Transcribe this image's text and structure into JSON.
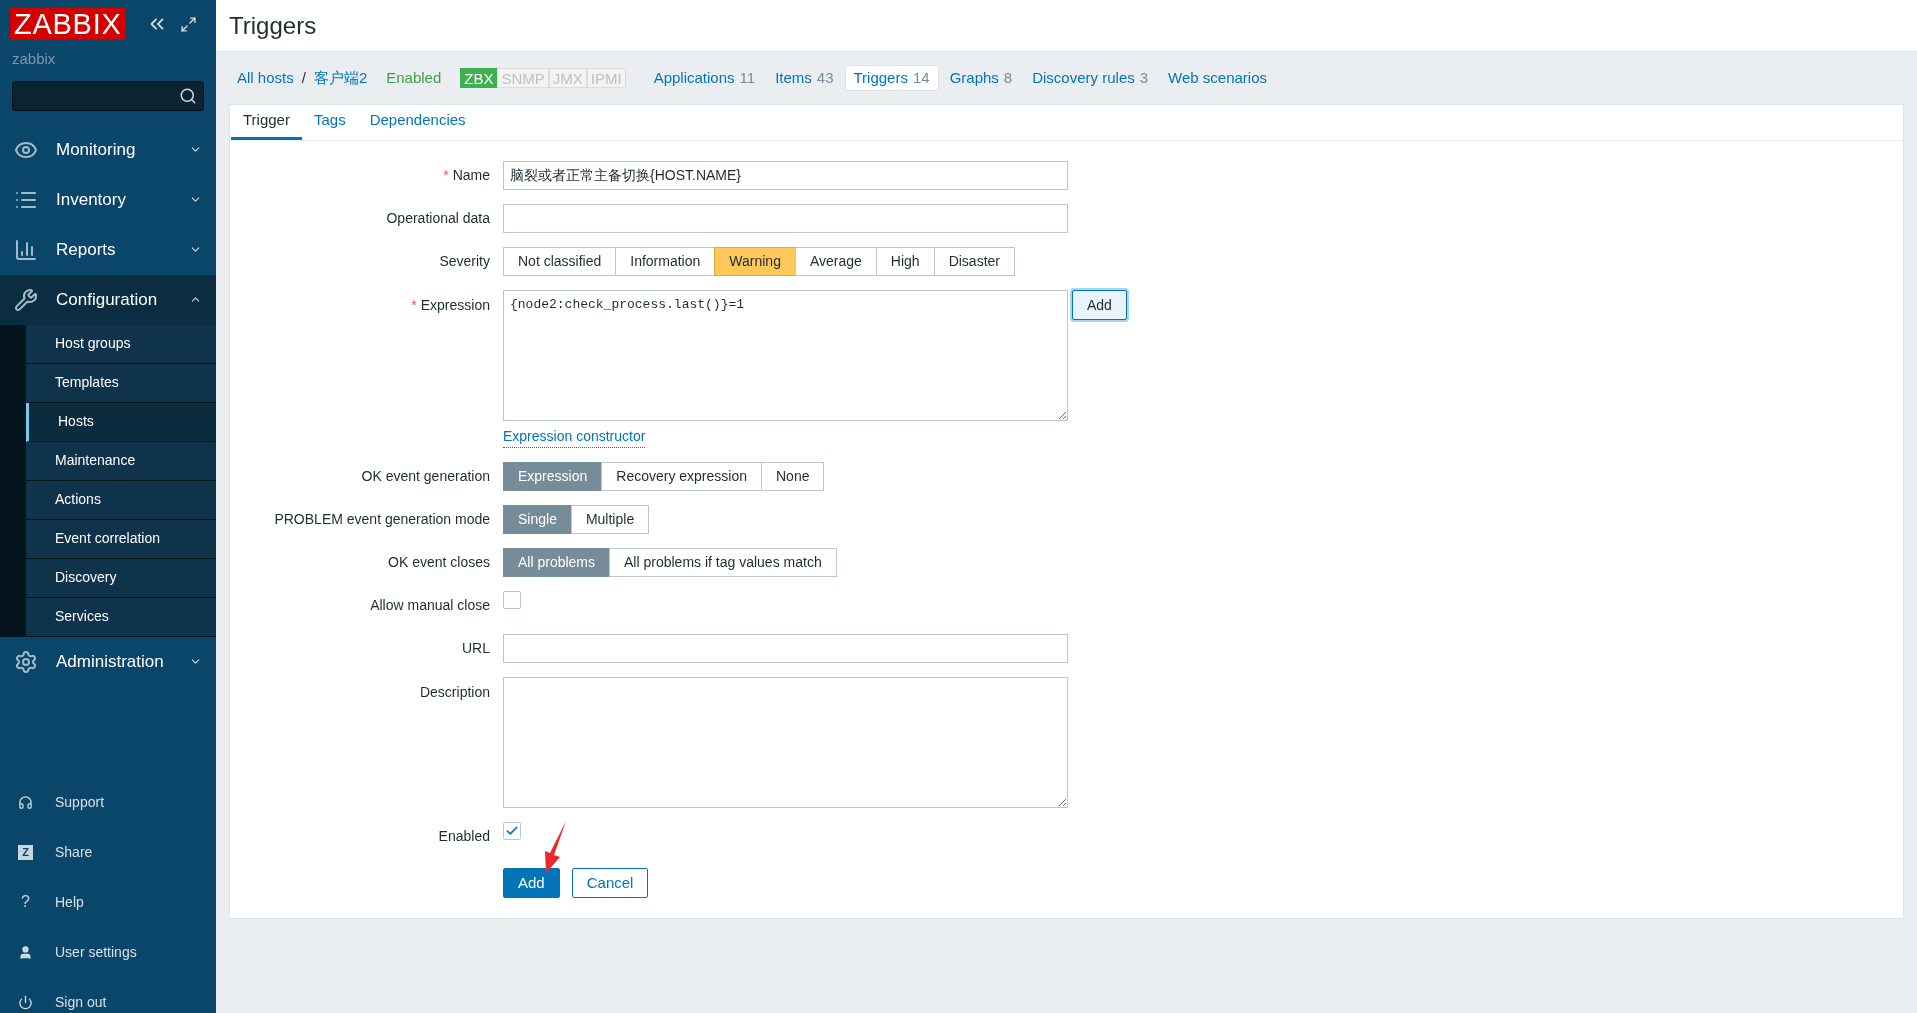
{
  "sidebar": {
    "logo": "ZABBIX",
    "user": "zabbix",
    "menu": [
      {
        "label": "Monitoring",
        "expanded": false
      },
      {
        "label": "Inventory",
        "expanded": false
      },
      {
        "label": "Reports",
        "expanded": false
      },
      {
        "label": "Configuration",
        "expanded": true,
        "children": [
          {
            "label": "Host groups",
            "selected": false
          },
          {
            "label": "Templates",
            "selected": false
          },
          {
            "label": "Hosts",
            "selected": true
          },
          {
            "label": "Maintenance",
            "selected": false
          },
          {
            "label": "Actions",
            "selected": false
          },
          {
            "label": "Event correlation",
            "selected": false
          },
          {
            "label": "Discovery",
            "selected": false
          },
          {
            "label": "Services",
            "selected": false
          }
        ]
      },
      {
        "label": "Administration",
        "expanded": false
      }
    ],
    "footer": [
      {
        "label": "Support"
      },
      {
        "label": "Share",
        "badge": "Z"
      },
      {
        "label": "Help",
        "badge": "?"
      },
      {
        "label": "User settings"
      },
      {
        "label": "Sign out"
      }
    ]
  },
  "page": {
    "title": "Triggers"
  },
  "host_nav": {
    "breadcrumbs": [
      "All hosts",
      "客户端2"
    ],
    "separator": "/",
    "status": "Enabled",
    "availability": [
      {
        "label": "ZBX",
        "on": true
      },
      {
        "label": "SNMP",
        "on": false
      },
      {
        "label": "JMX",
        "on": false
      },
      {
        "label": "IPMI",
        "on": false
      }
    ],
    "links": [
      {
        "label": "Applications",
        "count": "11",
        "selected": false
      },
      {
        "label": "Items",
        "count": "43",
        "selected": false
      },
      {
        "label": "Triggers",
        "count": "14",
        "selected": true
      },
      {
        "label": "Graphs",
        "count": "8",
        "selected": false
      },
      {
        "label": "Discovery rules",
        "count": "3",
        "selected": false
      },
      {
        "label": "Web scenarios",
        "selected": false
      }
    ]
  },
  "form_tabs": [
    {
      "label": "Trigger",
      "selected": true
    },
    {
      "label": "Tags",
      "selected": false
    },
    {
      "label": "Dependencies",
      "selected": false
    }
  ],
  "form": {
    "required_mark": "*",
    "fields": [
      {
        "kind": "text",
        "label": "Name",
        "required": true,
        "value": "脑裂或者正常主备切换{HOST.NAME}"
      },
      {
        "kind": "text",
        "label": "Operational data",
        "required": false
      },
      {
        "kind": "severity",
        "label": "Severity",
        "required": false,
        "options": [
          {
            "label": "Not classified",
            "selected": false
          },
          {
            "label": "Information",
            "selected": false
          },
          {
            "label": "Warning",
            "selected": true
          },
          {
            "label": "Average",
            "selected": false
          },
          {
            "label": "High",
            "selected": false
          },
          {
            "label": "Disaster",
            "selected": false
          }
        ]
      },
      {
        "kind": "expression",
        "label": "Expression",
        "required": true,
        "value": "{node2:check_process.last()}=1",
        "button": "Add",
        "link": "Expression constructor"
      },
      {
        "kind": "segmented",
        "label": "OK event generation",
        "required": false,
        "options": [
          {
            "label": "Expression",
            "selected": true
          },
          {
            "label": "Recovery expression",
            "selected": false
          },
          {
            "label": "None",
            "selected": false
          }
        ]
      },
      {
        "kind": "segmented",
        "label": "PROBLEM event generation mode",
        "required": false,
        "options": [
          {
            "label": "Single",
            "selected": true
          },
          {
            "label": "Multiple",
            "selected": false
          }
        ]
      },
      {
        "kind": "segmented",
        "label": "OK event closes",
        "required": false,
        "options": [
          {
            "label": "All problems",
            "selected": true
          },
          {
            "label": "All problems if tag values match",
            "selected": false
          }
        ]
      },
      {
        "kind": "checkbox",
        "label": "Allow manual close",
        "required": false,
        "checked": false
      },
      {
        "kind": "text",
        "label": "URL",
        "required": false
      },
      {
        "kind": "textarea",
        "label": "Description",
        "required": false
      },
      {
        "kind": "checkbox",
        "label": "Enabled",
        "required": false,
        "checked": true
      }
    ],
    "buttons": [
      {
        "label": "Add",
        "primary": true
      },
      {
        "label": "Cancel",
        "primary": false
      }
    ]
  }
}
